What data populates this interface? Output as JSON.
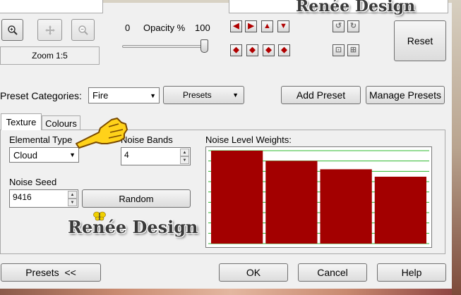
{
  "watermark": "Renée Design",
  "zoom": {
    "label": "Zoom 1:5"
  },
  "opacity": {
    "min_label": "0",
    "label": "Opacity %",
    "max_label": "100",
    "value": 100
  },
  "actions": {
    "reset": "Reset"
  },
  "preset_row": {
    "categories_label": "Preset Categories:",
    "category_value": "Fire",
    "presets_dropdown": "Presets",
    "add_preset": "Add Preset",
    "manage_presets": "Manage Presets"
  },
  "tabs": [
    {
      "label": "Texture",
      "active": true
    },
    {
      "label": "Colours",
      "active": false
    }
  ],
  "texture": {
    "elemental_type_label": "Elemental Type",
    "elemental_type_value": "Cloud",
    "noise_bands_label": "Noise Bands",
    "noise_bands_value": "4",
    "noise_seed_label": "Noise Seed",
    "noise_seed_value": "9416",
    "random_button": "Random",
    "weights_label": "Noise Level Weights:",
    "weights": [
      1.0,
      0.89,
      0.8,
      0.72
    ]
  },
  "colors": {
    "bar": "#a30000",
    "grid": "#2db82d"
  },
  "footer": {
    "presets": "Presets  <<",
    "ok": "OK",
    "cancel": "Cancel",
    "help": "Help"
  }
}
